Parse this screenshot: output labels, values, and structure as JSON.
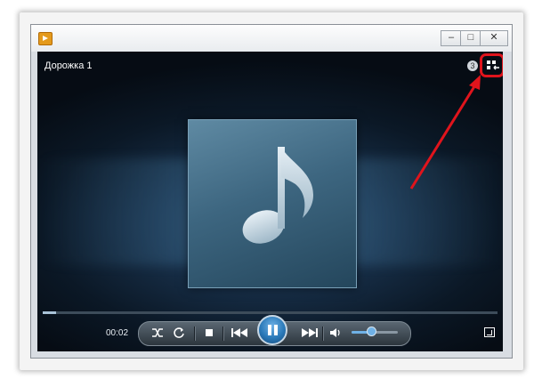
{
  "window": {
    "controls": {
      "minimize": "–",
      "maximize": "□",
      "close": "✕"
    }
  },
  "player": {
    "track_title": "Дорожка 1",
    "info_glyph": "3",
    "elapsed_time": "00:02",
    "progress_fraction": 0.03,
    "volume_fraction": 0.42,
    "state": "playing"
  },
  "icons": {
    "app": "media-player-icon",
    "switch_to_library": "switch-to-library-icon",
    "album_art": "music-note-icon",
    "shuffle": "shuffle-icon",
    "repeat": "repeat-icon",
    "stop": "stop-icon",
    "previous": "previous-icon",
    "pause": "pause-icon",
    "next": "next-icon",
    "mute": "speaker-icon",
    "fullscreen": "fullscreen-icon"
  },
  "colors": {
    "highlight": "#e0141c",
    "accent": "#2a79b8"
  }
}
